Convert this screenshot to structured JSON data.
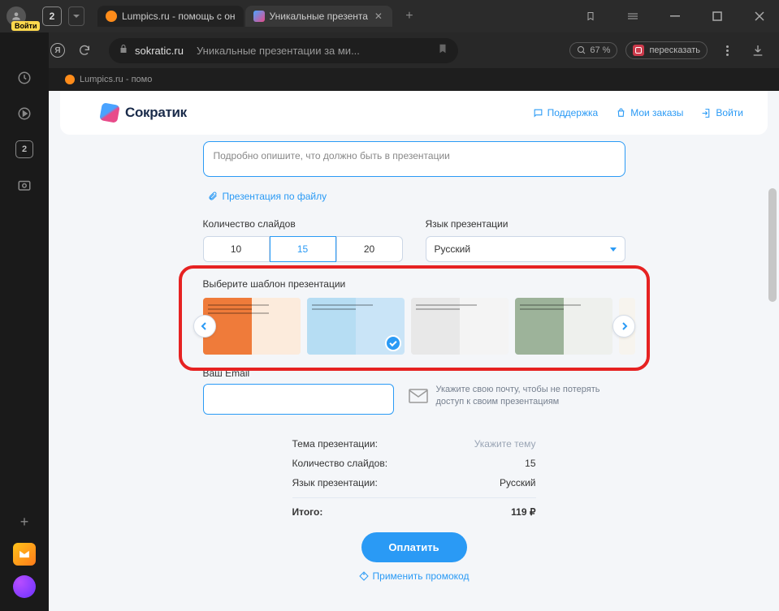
{
  "titlebar": {
    "login_badge": "Войти",
    "tab_counter": "2",
    "tabs": [
      {
        "title": "Lumpics.ru - помощь с он",
        "active": false
      },
      {
        "title": "Уникальные презента",
        "active": true
      }
    ]
  },
  "addressbar": {
    "ya_logo": "Я",
    "domain": "sokratic.ru",
    "page_title": "Уникальные презентации за ми...",
    "zoom": "67 %",
    "retell": "пересказать"
  },
  "sidebar": {
    "counter": "2"
  },
  "pinned": {
    "title": "Lumpics.ru - помо"
  },
  "header": {
    "brand": "Сократик",
    "support": "Поддержка",
    "orders": "Мои заказы",
    "login": "Войти"
  },
  "form": {
    "desc_placeholder": "Подробно опишите, что должно быть в презентации",
    "file_link": "Презентация по файлу",
    "slides_label": "Количество слайдов",
    "slides_options": [
      "10",
      "15",
      "20"
    ],
    "slides_selected": "15",
    "lang_label": "Язык презентации",
    "lang_value": "Русский",
    "template_label": "Выберите шаблон презентации",
    "email_label": "Ваш Email",
    "email_hint": "Укажите свою почту, чтобы не потерять доступ к своим презентациям"
  },
  "summary": {
    "rows": [
      {
        "k": "Тема презентации:",
        "v": "Укажите тему",
        "muted": true
      },
      {
        "k": "Количество слайдов:",
        "v": "15"
      },
      {
        "k": "Язык презентации:",
        "v": "Русский"
      }
    ],
    "total_label": "Итого:",
    "total_value": "119 ₽",
    "pay": "Оплатить",
    "promo": "Применить промокод"
  }
}
